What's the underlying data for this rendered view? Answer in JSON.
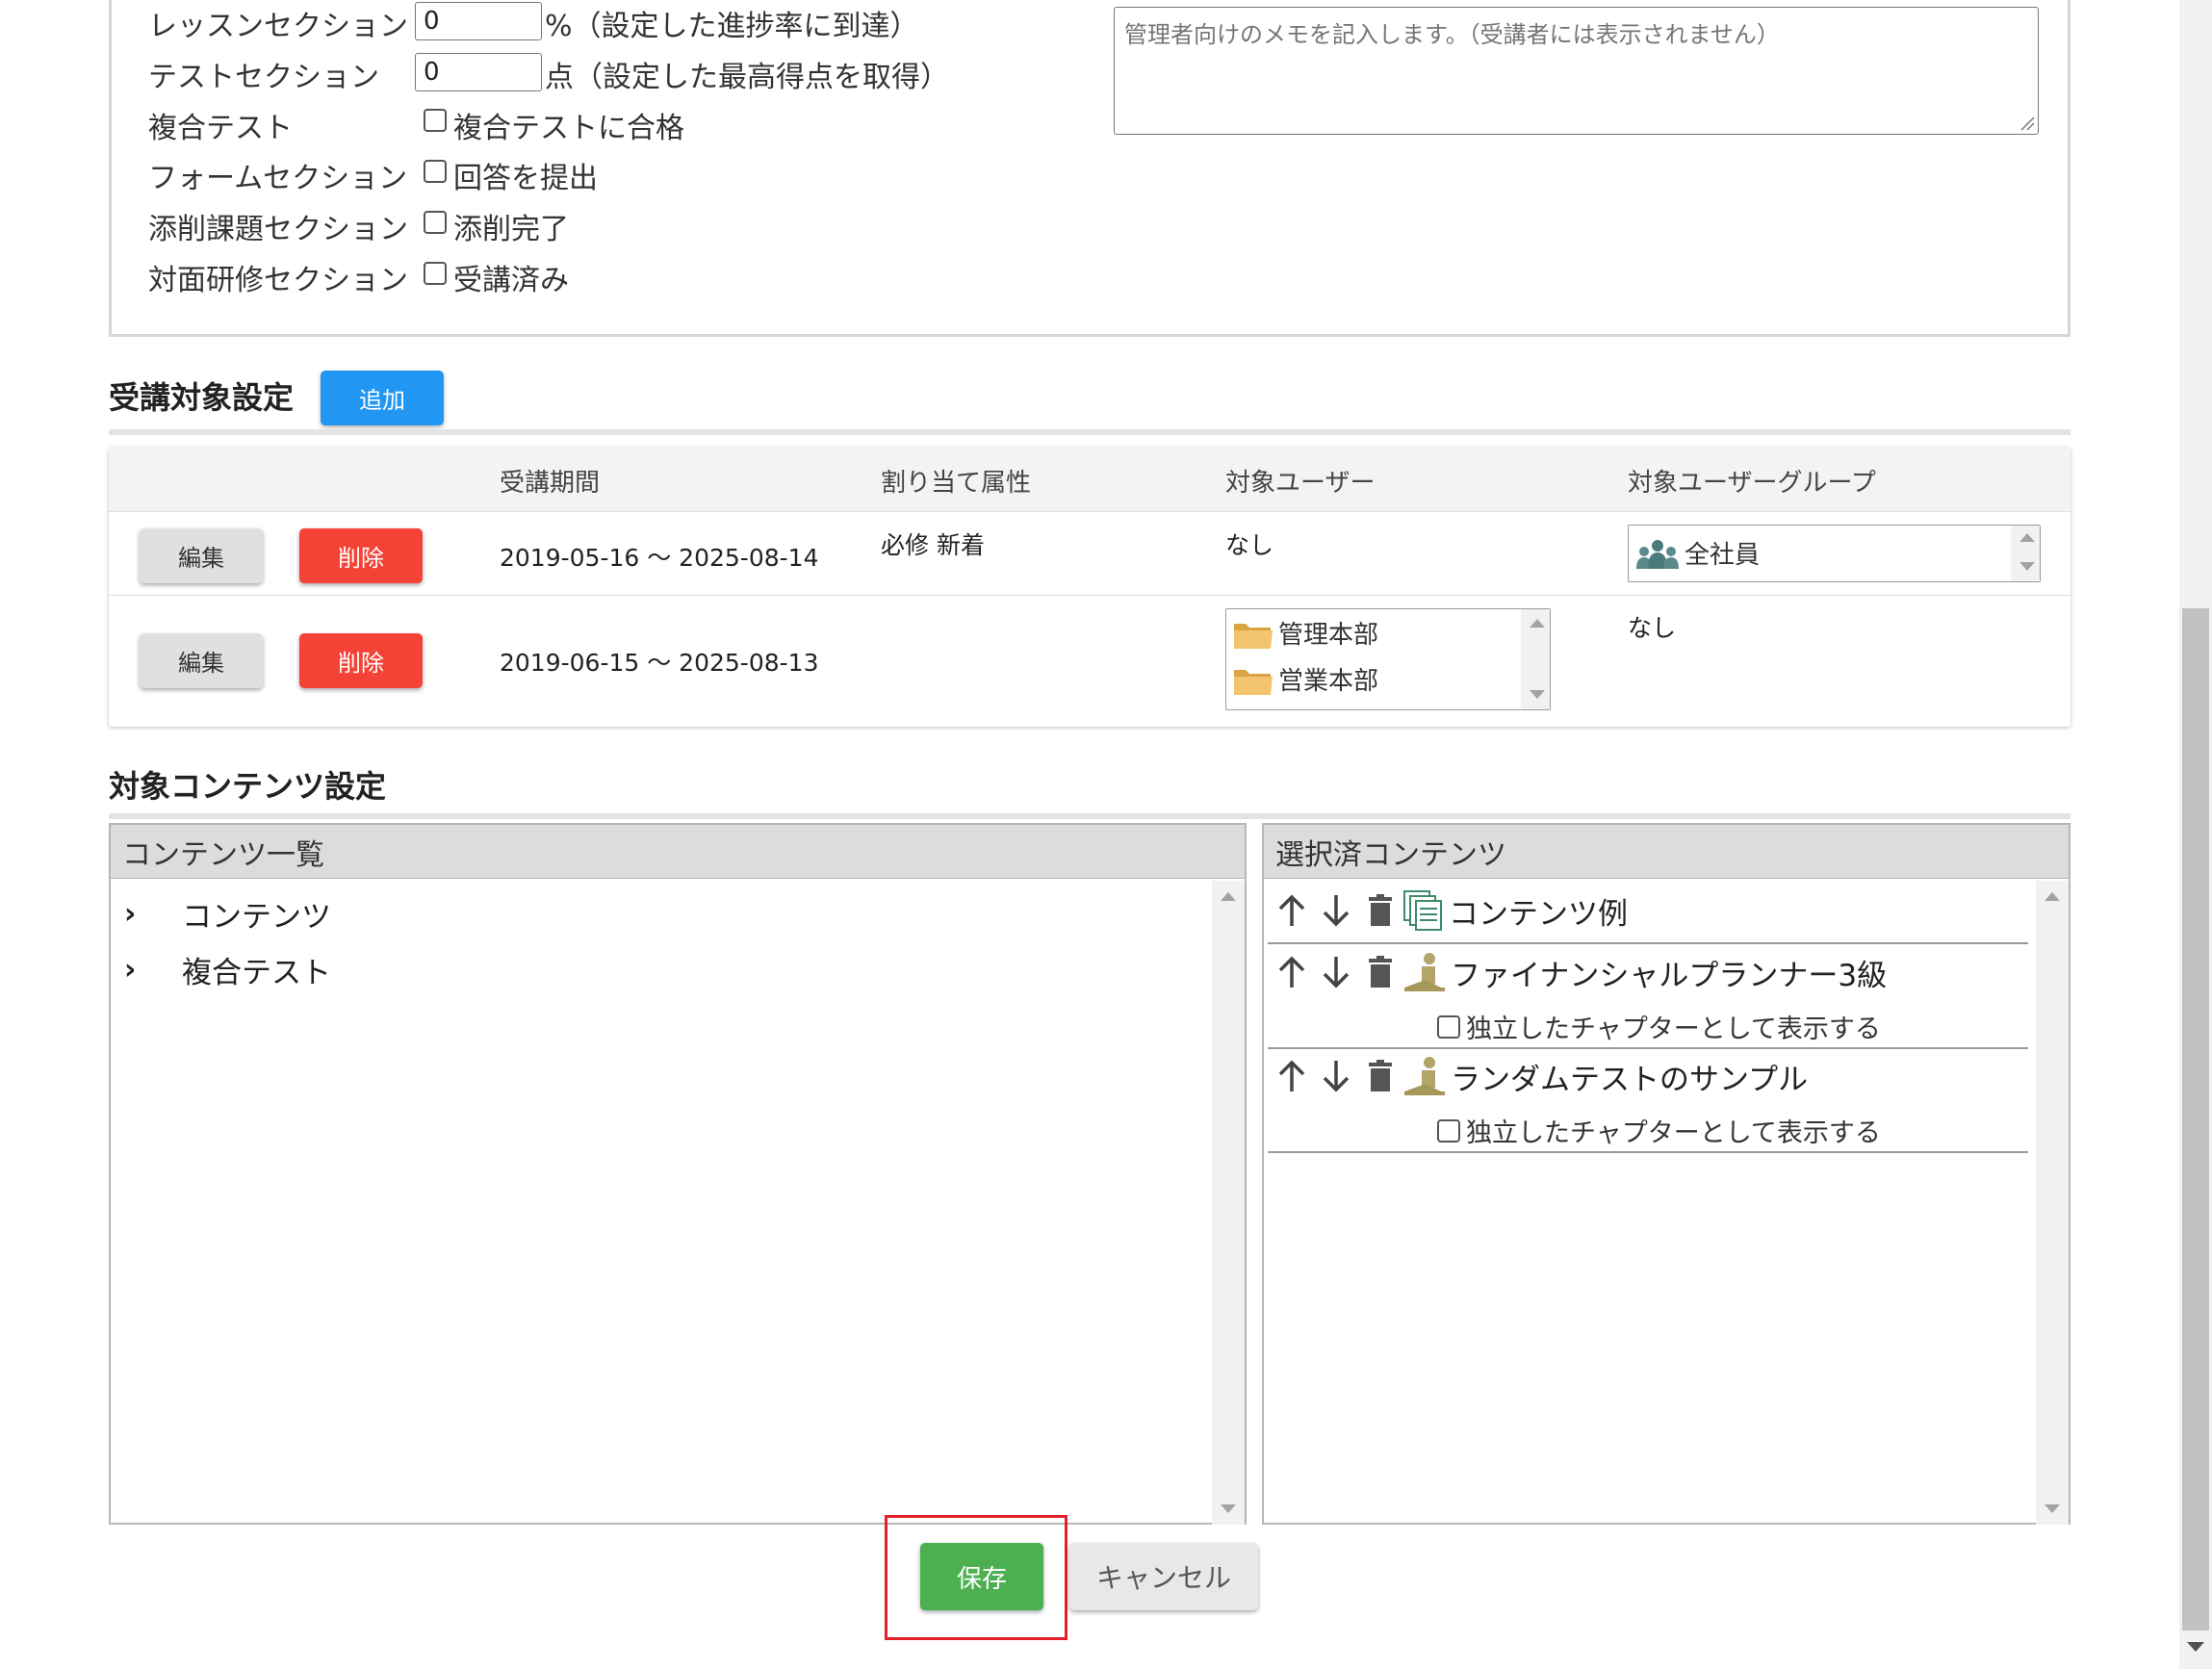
{
  "completion": {
    "rows": [
      {
        "label": "レッスンセクション",
        "type": "number",
        "value": "0",
        "suffix": "%（設定した進捗率に到達）"
      },
      {
        "label": "テストセクション",
        "type": "number",
        "value": "0",
        "suffix": "点（設定した最高得点を取得）"
      },
      {
        "label": "複合テスト",
        "type": "checkbox",
        "suffix": "複合テストに合格"
      },
      {
        "label": "フォームセクション",
        "type": "checkbox",
        "suffix": "回答を提出"
      },
      {
        "label": "添削課題セクション",
        "type": "checkbox",
        "suffix": "添削完了"
      },
      {
        "label": "対面研修セクション",
        "type": "checkbox",
        "suffix": "受講済み"
      }
    ],
    "memo_placeholder": "管理者向けのメモを記入します。（受講者には表示されません）"
  },
  "target": {
    "title": "受講対象設定",
    "add_label": "追加",
    "columns": [
      "受講期間",
      "割り当て属性",
      "対象ユーザー",
      "対象ユーザーグループ"
    ],
    "edit_label": "編集",
    "delete_label": "削除",
    "rows": [
      {
        "period": "2019-05-16 〜 2025-08-14",
        "attributes": "必修 新着",
        "users": "なし",
        "groups": [
          "全社員"
        ]
      },
      {
        "period": "2019-06-15 〜 2025-08-13",
        "attributes": "",
        "users": [
          "管理本部",
          "営業本部"
        ],
        "groups": "なし"
      }
    ]
  },
  "content": {
    "title": "対象コンテンツ設定",
    "list_header": "コンテンツ一覧",
    "list_items": [
      "コンテンツ",
      "複合テスト"
    ],
    "selected_header": "選択済コンテンツ",
    "selected_items": [
      {
        "name": "コンテンツ例",
        "icon": "content-pages-icon",
        "has_option": false
      },
      {
        "name": "ファイナンシャルプランナー3級",
        "icon": "lesson-person-icon",
        "has_option": true,
        "option": "独立したチャプターとして表示する"
      },
      {
        "name": "ランダムテストのサンプル",
        "icon": "lesson-person-icon",
        "has_option": true,
        "option": "独立したチャプターとして表示する"
      }
    ]
  },
  "footer": {
    "save_label": "保存",
    "cancel_label": "キャンセル"
  },
  "colors": {
    "primary": "#2196f3",
    "danger": "#f44336",
    "success": "#4caf50",
    "highlight": "#e0202a"
  }
}
